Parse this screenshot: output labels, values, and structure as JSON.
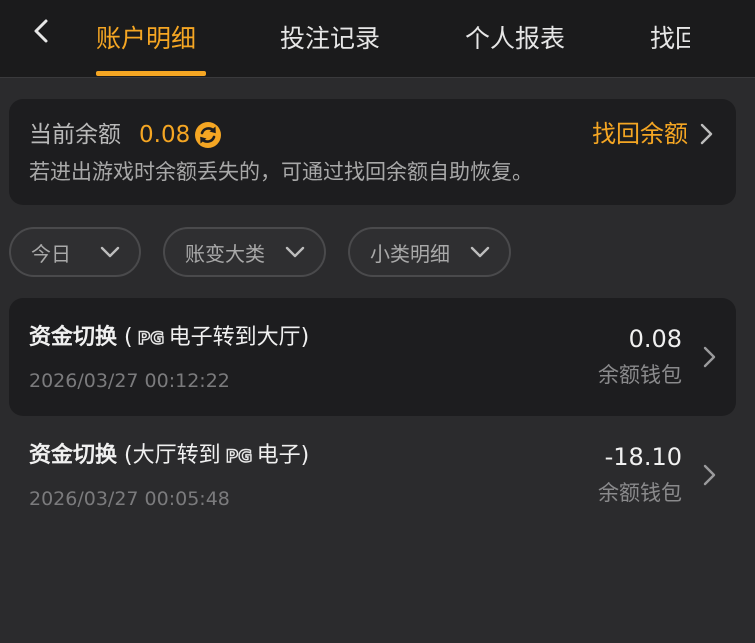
{
  "nav": {
    "back_icon": "chevron-left-icon",
    "tabs": [
      {
        "label": "账户明细",
        "active": true
      },
      {
        "label": "投注记录",
        "active": false
      },
      {
        "label": "个人报表",
        "active": false
      },
      {
        "label": "找回",
        "active": false
      }
    ]
  },
  "balance": {
    "label": "当前余额",
    "value": "0.08",
    "refresh_icon": "refresh-icon",
    "recover_label": "找回余额",
    "note": "若进出游戏时余额丢失的，可通过找回余额自助恢复。"
  },
  "filters": [
    {
      "label": "今日"
    },
    {
      "label": "账变大类"
    },
    {
      "label": "小类明细"
    }
  ],
  "transactions": [
    {
      "title": "资金切换",
      "paren_open": " (",
      "detail_before": "",
      "logo": "PG",
      "detail_after": "电子转到大厅)",
      "time": "2026/03/27 00:12:22",
      "amount": "0.08",
      "wallet": "余额钱包"
    },
    {
      "title": "资金切换",
      "paren_open": " (",
      "detail_before": "大厅转到",
      "logo": "PG",
      "detail_after": "电子)",
      "time": "2026/03/27 00:05:48",
      "amount": "-18.10",
      "wallet": "余额钱包"
    }
  ],
  "colors": {
    "accent": "#f5a623",
    "background": "#2b2b2d",
    "card": "#1d1d1f",
    "header": "#1b1b1c"
  }
}
